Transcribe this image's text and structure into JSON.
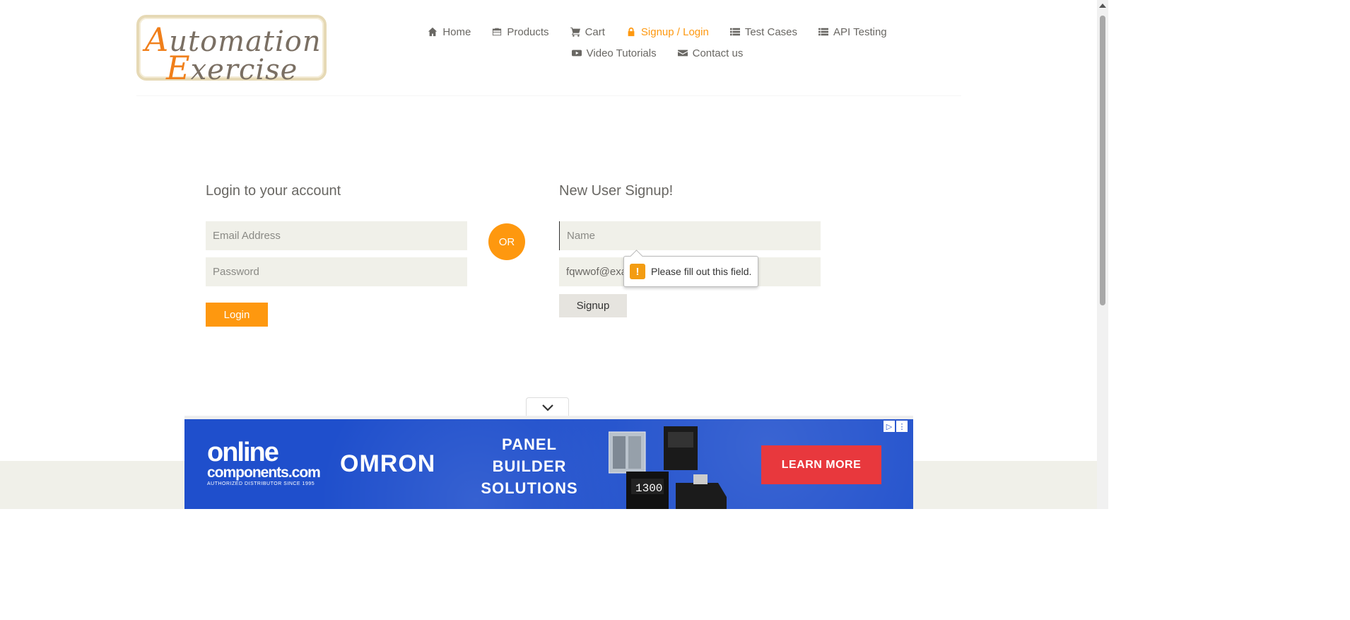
{
  "logo": {
    "line1_first": "A",
    "line1_rest": "utomation",
    "line2_first": "E",
    "line2_rest": "xercise"
  },
  "nav": {
    "row1": [
      {
        "label": "Home",
        "icon": "home-icon"
      },
      {
        "label": "Products",
        "icon": "briefcase-icon"
      },
      {
        "label": "Cart",
        "icon": "cart-icon"
      },
      {
        "label": "Signup / Login",
        "icon": "lock-icon",
        "active": true
      },
      {
        "label": "Test Cases",
        "icon": "list-icon"
      },
      {
        "label": "API Testing",
        "icon": "list-icon"
      }
    ],
    "row2": [
      {
        "label": "Video Tutorials",
        "icon": "youtube-icon"
      },
      {
        "label": "Contact us",
        "icon": "envelope-icon"
      }
    ]
  },
  "login": {
    "title": "Login to your account",
    "email_placeholder": "Email Address",
    "password_placeholder": "Password",
    "button": "Login"
  },
  "or_label": "OR",
  "signup": {
    "title": "New User Signup!",
    "name_placeholder": "Name",
    "email_value": "fqwwof@example.com",
    "button": "Signup",
    "validation_tooltip": "Please fill out this field."
  },
  "ad": {
    "brand_line1": "online",
    "brand_line2": "components.com",
    "brand_tagline": "AUTHORIZED DISTRIBUTOR SINCE 1995",
    "partner": "OMRON",
    "headline": "PANEL BUILDER SOLUTIONS",
    "cta": "LEARN MORE",
    "colors": {
      "background": "#1f4fcc",
      "cta": "#e8383d"
    }
  },
  "colors": {
    "accent": "#fe980f",
    "input_bg": "#f0f0e9",
    "text": "#696763"
  }
}
